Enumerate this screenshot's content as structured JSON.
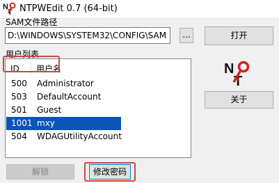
{
  "window": {
    "title": "NTPWEdit 0.7 (64-bit)"
  },
  "sam": {
    "label": "SAM文件路径",
    "path_value": "D:\\WINDOWS\\SYSTEM32\\CONFIG\\SAM",
    "browse_label": "...",
    "open_label": "打开"
  },
  "userlist": {
    "label": "用户列表",
    "columns": [
      "ID",
      "用户名"
    ],
    "rows": [
      {
        "id": "500",
        "name": "Administrator"
      },
      {
        "id": "503",
        "name": "DefaultAccount"
      },
      {
        "id": "501",
        "name": "Guest"
      },
      {
        "id": "1001",
        "name": "mxy"
      },
      {
        "id": "504",
        "name": "WDAGUtilityAccount"
      }
    ],
    "selected_index": 3
  },
  "buttons": {
    "about_label": "关于",
    "unlock_label": "解锁",
    "change_password_label": "修改密码"
  },
  "icons": {
    "app": "nt-key-app-icon",
    "logo": "nt-key-logo-icon"
  },
  "colors": {
    "selection": "#0a54b8",
    "highlight_frame": "#c94747",
    "logo_red": "#d42020"
  }
}
